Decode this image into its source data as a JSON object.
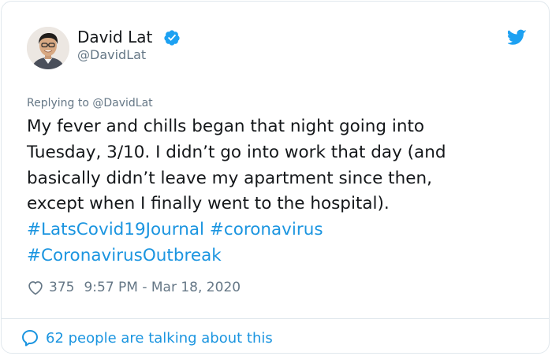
{
  "author": {
    "display_name": "David Lat",
    "handle": "@DavidLat",
    "verified": true,
    "avatar_icon": "user-avatar-photo"
  },
  "platform_icon": "twitter-bird-icon",
  "reply_context": "Replying to @DavidLat",
  "tweet": {
    "lines": [
      "My fever and chills began that night going into",
      "Tuesday, 3/10. I didn’t go into work that day (and",
      "basically didn’t leave my apartment since then,",
      "except when I finally went to the hospital)."
    ],
    "hashtags": [
      "#LatsCovid19Journal",
      "#coronavirus",
      "#CoronavirusOutbreak"
    ]
  },
  "meta": {
    "like_count": "375",
    "timestamp": "9:57 PM - Mar 18, 2020"
  },
  "footer": {
    "conversation_text": "62 people are talking about this"
  },
  "colors": {
    "accent": "#1b95e0",
    "muted": "#657786",
    "text": "#14171a",
    "border": "#e1e8ed",
    "verified_badge": "#1da1f2"
  }
}
